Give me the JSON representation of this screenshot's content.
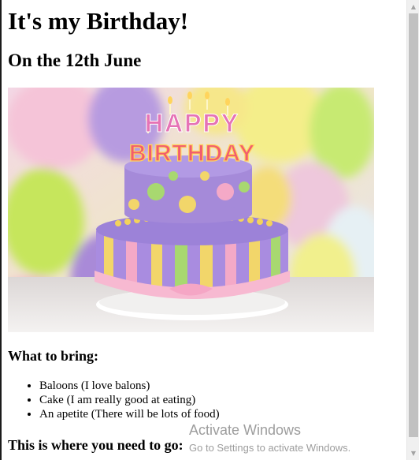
{
  "page": {
    "title": "It's my Birthday!",
    "subtitle": "On the 12th June"
  },
  "hero_image": {
    "cake_topper_line1": "HAPPY",
    "cake_topper_line2": "BIRTHDAY"
  },
  "bring_section": {
    "heading": "What to bring:",
    "items": [
      "Baloons (I love balons)",
      "Cake (I am really good at eating)",
      "An apetite (There will be lots of food)"
    ]
  },
  "location_section": {
    "heading": "This is where you need to go:"
  },
  "watermark": {
    "title": "Activate Windows",
    "subtitle": "Go to Settings to activate Windows."
  }
}
